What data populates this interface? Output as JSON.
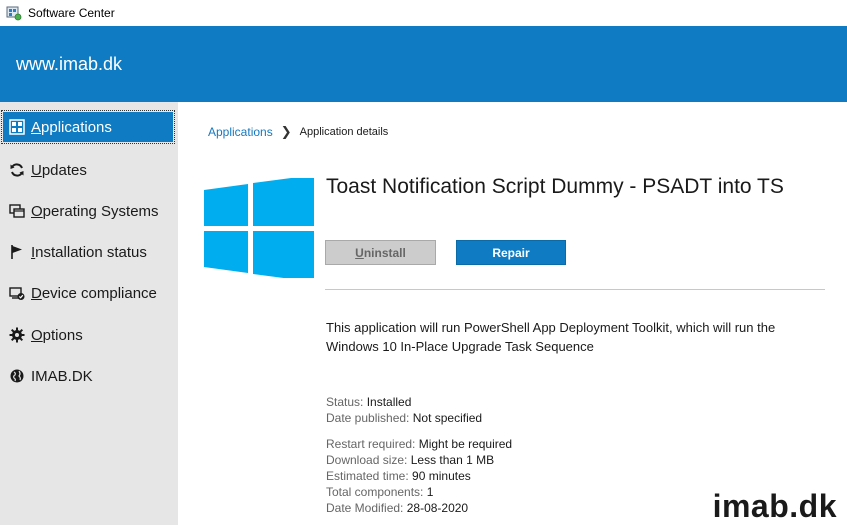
{
  "window": {
    "title": "Software Center"
  },
  "banner": {
    "org_name": "www.imab.dk",
    "color": "#0e7bc3"
  },
  "sidebar": {
    "items": [
      {
        "label_first": "A",
        "label_rest": "pplications",
        "icon": "grid-icon",
        "selected": true
      },
      {
        "label_first": "U",
        "label_rest": "pdates",
        "icon": "refresh-icon",
        "selected": false
      },
      {
        "label_first": "O",
        "label_rest": "perating Systems",
        "icon": "windows-stack-icon",
        "selected": false
      },
      {
        "label_first": "I",
        "label_rest": "nstallation status",
        "icon": "flag-icon",
        "selected": false
      },
      {
        "label_first": "D",
        "label_rest": "evice compliance",
        "icon": "device-check-icon",
        "selected": false
      },
      {
        "label_first": "O",
        "label_rest": "ptions",
        "icon": "gear-icon",
        "selected": false
      },
      {
        "label": "IMAB.DK",
        "icon": "globe-icon",
        "selected": false
      }
    ]
  },
  "breadcrumb": {
    "parent": "Applications",
    "current": "Application details"
  },
  "app": {
    "title": "Toast Notification Script Dummy - PSADT into TS",
    "uninstall_first": "U",
    "uninstall_rest": "ninstall",
    "repair_label": "Repair",
    "description": "This application will run PowerShell App Deployment Toolkit, which will run the Windows 10 In-Place Upgrade Task Sequence",
    "details_a": [
      {
        "key": "Status:",
        "value": "Installed"
      },
      {
        "key": "Date published:",
        "value": "Not specified"
      }
    ],
    "details_b": [
      {
        "key": "Restart required:",
        "value": "Might be required"
      },
      {
        "key": "Download size:",
        "value": "Less than 1 MB"
      },
      {
        "key": "Estimated time:",
        "value": "90 minutes"
      },
      {
        "key": "Total components:",
        "value": "1"
      },
      {
        "key": "Date Modified:",
        "value": "28-08-2020"
      }
    ]
  },
  "watermark": "imab.dk",
  "colors": {
    "accent": "#0e7bc3",
    "logo_blue": "#00adef",
    "sidebar_bg": "#e6e6e6"
  }
}
